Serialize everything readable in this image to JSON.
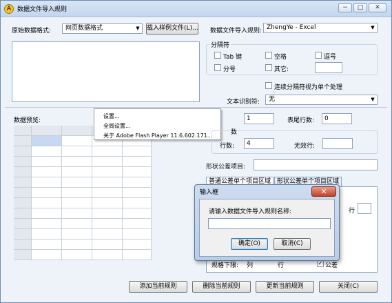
{
  "window": {
    "title": "数据文件导入规则",
    "app_icon": "A",
    "controls": {
      "minimize": "−",
      "maximize": "□",
      "close": "✕"
    }
  },
  "top": {
    "source_format_label": "原始数据格式:",
    "source_format_value": "网页数据格式",
    "load_sample_button": "载入样例文件(L)...",
    "rule_label": "数据文件导入规则:",
    "rule_value": "ZhengYe - Excel"
  },
  "separator": {
    "group_title": "分隔符",
    "tab": "Tab 键",
    "space": "空格",
    "comma": "逗号",
    "semicolon": "分号",
    "other": "其它:",
    "consecutive": "连续分隔符视为单个处理",
    "text_qualifier_label": "文本识别符:",
    "text_qualifier_value": "无"
  },
  "preview": {
    "label": "数据预览:"
  },
  "context_menu": {
    "items": [
      "设置...",
      "全局设置...",
      "关于 Adobe Flash Player 11.6.602.171..."
    ]
  },
  "rows": {
    "header_rows_value": "1",
    "footer_rows_label": "表尾行数:",
    "footer_rows_value": "0",
    "group_title": "数",
    "rows_label": "行数:",
    "rows_value": "4",
    "invalid_rows_label": "无效行:",
    "invalid_rows_value": ""
  },
  "shape": {
    "label": "形状公差项目:",
    "value": ""
  },
  "tabs": [
    "普通公差单个项目区域",
    "形状公差单个项目区域"
  ],
  "tab_content": {
    "row_label": "行",
    "spec_lower_label": "规格下限:",
    "col_label": "列",
    "row_label2": "行",
    "tolerance_label": "公差",
    "tolerance_checked": true
  },
  "input_dialog": {
    "title": "输入框",
    "close": "✕",
    "prompt": "请输入数据文件导入规则名称:",
    "value": "",
    "ok": "确定(O)",
    "cancel": "取消(C)"
  },
  "bottom_buttons": {
    "add": "添加当前规则",
    "delete": "删除当前规则",
    "update": "更新当前规则",
    "close": "关闭(C)"
  }
}
